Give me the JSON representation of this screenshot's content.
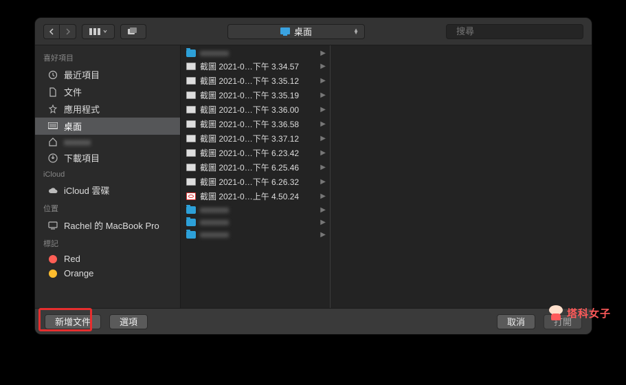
{
  "titlebar": {
    "path_label": "桌面",
    "search_placeholder": "搜尋"
  },
  "sidebar": {
    "sections": [
      {
        "title": "喜好項目",
        "items": [
          {
            "icon": "recent-icon",
            "label": "最近項目"
          },
          {
            "icon": "document-icon",
            "label": "文件"
          },
          {
            "icon": "apps-icon",
            "label": "應用程式"
          },
          {
            "icon": "desktop-icon",
            "label": "桌面",
            "selected": true
          },
          {
            "icon": "home-icon",
            "label": ""
          },
          {
            "icon": "downloads-icon",
            "label": "下載項目"
          }
        ]
      },
      {
        "title": "iCloud",
        "items": [
          {
            "icon": "cloud-icon",
            "label": "iCloud 雲碟"
          }
        ]
      },
      {
        "title": "位置",
        "items": [
          {
            "icon": "computer-icon",
            "label": "Rachel 的 MacBook Pro"
          }
        ]
      },
      {
        "title": "標記",
        "items": [
          {
            "icon": "tag-dot",
            "color": "#ff5f56",
            "label": "Red"
          },
          {
            "icon": "tag-dot",
            "color": "#ffbd2e",
            "label": "Orange"
          }
        ]
      }
    ]
  },
  "column": {
    "rows": [
      {
        "type": "folder",
        "label": "",
        "blur": true
      },
      {
        "type": "image",
        "label": "截圖 2021-0…下午 3.34.57"
      },
      {
        "type": "image",
        "label": "截圖 2021-0…下午 3.35.12"
      },
      {
        "type": "image",
        "label": "截圖 2021-0…下午 3.35.19"
      },
      {
        "type": "image",
        "label": "截圖 2021-0…下午 3.36.00"
      },
      {
        "type": "image",
        "label": "截圖 2021-0…下午 3.36.58"
      },
      {
        "type": "image",
        "label": "截圖 2021-0…下午 3.37.12"
      },
      {
        "type": "image",
        "label": "截圖 2021-0…下午 6.23.42"
      },
      {
        "type": "image",
        "label": "截圖 2021-0…下午 6.25.46"
      },
      {
        "type": "image",
        "label": "截圖 2021-0…下午 6.26.32"
      },
      {
        "type": "image-red",
        "label": "截圖 2021-0…上午 4.50.24"
      },
      {
        "type": "folder",
        "label": "",
        "blur": true
      },
      {
        "type": "folder",
        "label": "",
        "blur": true
      },
      {
        "type": "folder",
        "label": "",
        "blur": true
      }
    ]
  },
  "bottom": {
    "new_folder": "新增文件",
    "options": "選項",
    "cancel": "取消",
    "open": "打開"
  },
  "watermark": "塔科女子"
}
